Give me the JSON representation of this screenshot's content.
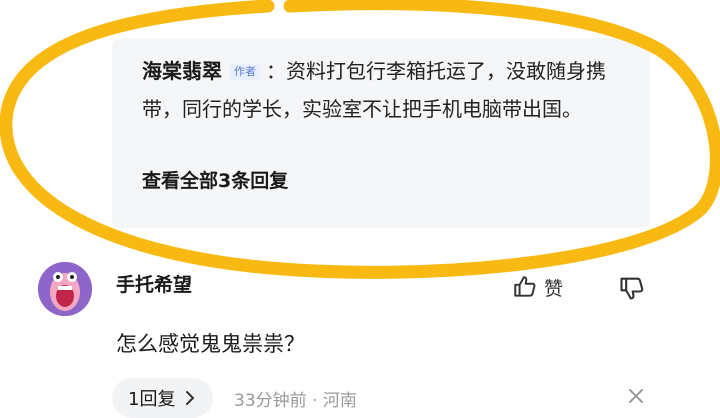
{
  "reply": {
    "author": "海棠翡翠",
    "badge": "作者",
    "separator": "：",
    "text": "资料打包行李箱托运了，没敢随身携带，同行的学长，实验室不让把手机电脑带出国。",
    "view_all": "查看全部3条回复"
  },
  "comment": {
    "username": "手托希望",
    "like_label": "赞",
    "text": "怎么感觉鬼鬼祟祟？",
    "reply_count": "1回复",
    "time_location": "33分钟前 · 河南"
  },
  "colors": {
    "highlight": "#f7b500",
    "avatar_bg": "#8e66c9",
    "badge_text": "#5b7bd5"
  },
  "icons": [
    "thumbs-up-icon",
    "thumbs-down-icon",
    "chevron-right-icon",
    "close-icon"
  ]
}
